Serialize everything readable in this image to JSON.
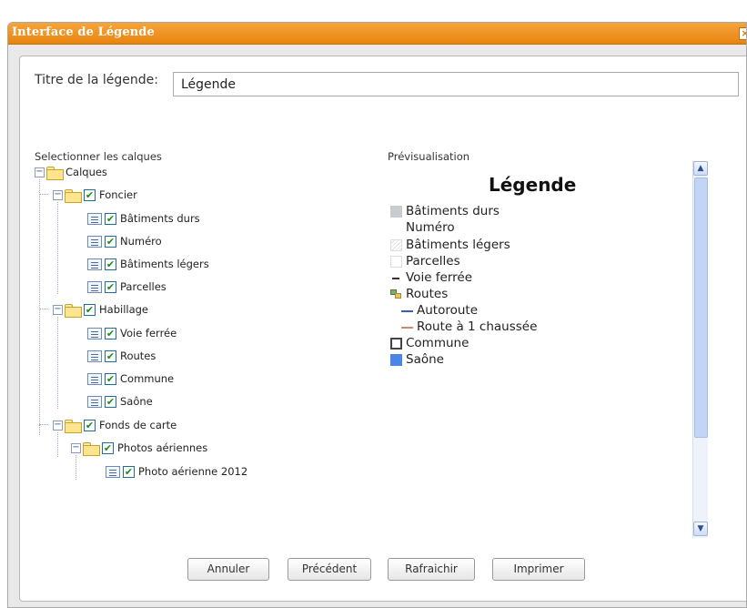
{
  "window": {
    "title": "Interface de Légende",
    "close_icon": "close-icon"
  },
  "form": {
    "title_label": "Titre de la légende:",
    "title_value": "Légende",
    "layers_label": "Selectionner les calques",
    "preview_label": "Prévisualisation"
  },
  "tree": {
    "root": "Calques",
    "foncier": "Foncier",
    "foncier_items": [
      "Bâtiments durs",
      "Numéro",
      "Bâtiments légers",
      "Parcelles"
    ],
    "habillage": "Habillage",
    "habillage_items": [
      "Voie ferrée",
      "Routes",
      "Commune",
      "Saône"
    ],
    "fonds": "Fonds de carte",
    "photos": "Photos aériennes",
    "photo_items": [
      "Photo aérienne 2012"
    ],
    "check_mark": "✔",
    "expand_mark": "−"
  },
  "preview": {
    "title": "Légende",
    "items": [
      {
        "label": "Bâtiments durs",
        "color": "#c8ccd0"
      },
      {
        "label": "Numéro",
        "color": ""
      },
      {
        "label": "Bâtiments légers",
        "color": "#f2f2f2"
      },
      {
        "label": "Parcelles",
        "color": "#ffffff"
      },
      {
        "label": "Voie ferrée",
        "color": "#333333"
      },
      {
        "label": "Routes",
        "color": "#6a9a5a"
      },
      {
        "label": "Autoroute",
        "color": "#3b5fb0"
      },
      {
        "label": "Route à 1 chaussée",
        "color": "#d38a6a"
      },
      {
        "label": "Commune",
        "color": "#444444"
      },
      {
        "label": "Saône",
        "color": "#4a86e8"
      }
    ]
  },
  "buttons": {
    "cancel": "Annuler",
    "previous": "Précédent",
    "refresh": "Rafraichir",
    "print": "Imprimer"
  },
  "colors": {
    "titlebar": "#e88410",
    "check": "#1a8a1a"
  }
}
